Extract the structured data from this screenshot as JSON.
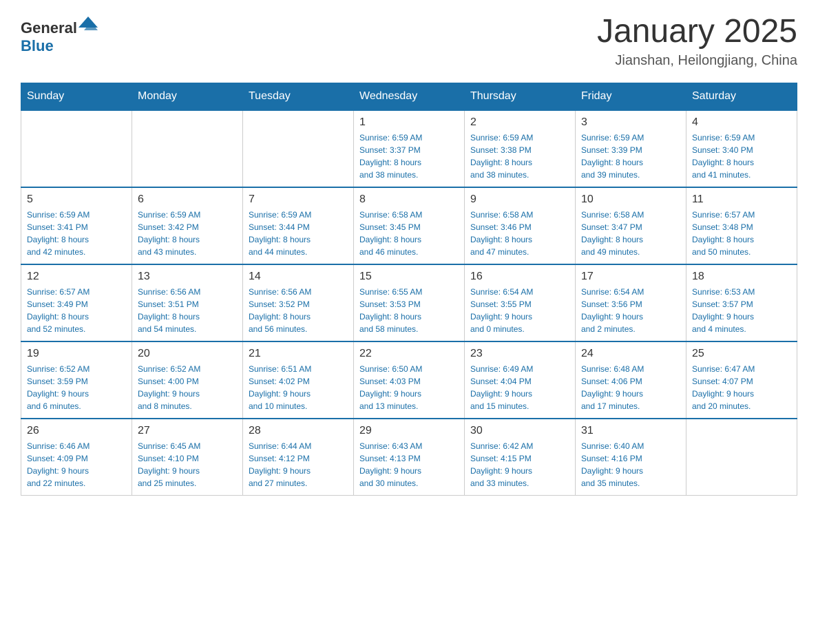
{
  "header": {
    "logo": {
      "general": "General",
      "blue": "Blue"
    },
    "title": "January 2025",
    "subtitle": "Jianshan, Heilongjiang, China"
  },
  "days_of_week": [
    "Sunday",
    "Monday",
    "Tuesday",
    "Wednesday",
    "Thursday",
    "Friday",
    "Saturday"
  ],
  "weeks": [
    [
      {
        "day": "",
        "info": ""
      },
      {
        "day": "",
        "info": ""
      },
      {
        "day": "",
        "info": ""
      },
      {
        "day": "1",
        "info": "Sunrise: 6:59 AM\nSunset: 3:37 PM\nDaylight: 8 hours\nand 38 minutes."
      },
      {
        "day": "2",
        "info": "Sunrise: 6:59 AM\nSunset: 3:38 PM\nDaylight: 8 hours\nand 38 minutes."
      },
      {
        "day": "3",
        "info": "Sunrise: 6:59 AM\nSunset: 3:39 PM\nDaylight: 8 hours\nand 39 minutes."
      },
      {
        "day": "4",
        "info": "Sunrise: 6:59 AM\nSunset: 3:40 PM\nDaylight: 8 hours\nand 41 minutes."
      }
    ],
    [
      {
        "day": "5",
        "info": "Sunrise: 6:59 AM\nSunset: 3:41 PM\nDaylight: 8 hours\nand 42 minutes."
      },
      {
        "day": "6",
        "info": "Sunrise: 6:59 AM\nSunset: 3:42 PM\nDaylight: 8 hours\nand 43 minutes."
      },
      {
        "day": "7",
        "info": "Sunrise: 6:59 AM\nSunset: 3:44 PM\nDaylight: 8 hours\nand 44 minutes."
      },
      {
        "day": "8",
        "info": "Sunrise: 6:58 AM\nSunset: 3:45 PM\nDaylight: 8 hours\nand 46 minutes."
      },
      {
        "day": "9",
        "info": "Sunrise: 6:58 AM\nSunset: 3:46 PM\nDaylight: 8 hours\nand 47 minutes."
      },
      {
        "day": "10",
        "info": "Sunrise: 6:58 AM\nSunset: 3:47 PM\nDaylight: 8 hours\nand 49 minutes."
      },
      {
        "day": "11",
        "info": "Sunrise: 6:57 AM\nSunset: 3:48 PM\nDaylight: 8 hours\nand 50 minutes."
      }
    ],
    [
      {
        "day": "12",
        "info": "Sunrise: 6:57 AM\nSunset: 3:49 PM\nDaylight: 8 hours\nand 52 minutes."
      },
      {
        "day": "13",
        "info": "Sunrise: 6:56 AM\nSunset: 3:51 PM\nDaylight: 8 hours\nand 54 minutes."
      },
      {
        "day": "14",
        "info": "Sunrise: 6:56 AM\nSunset: 3:52 PM\nDaylight: 8 hours\nand 56 minutes."
      },
      {
        "day": "15",
        "info": "Sunrise: 6:55 AM\nSunset: 3:53 PM\nDaylight: 8 hours\nand 58 minutes."
      },
      {
        "day": "16",
        "info": "Sunrise: 6:54 AM\nSunset: 3:55 PM\nDaylight: 9 hours\nand 0 minutes."
      },
      {
        "day": "17",
        "info": "Sunrise: 6:54 AM\nSunset: 3:56 PM\nDaylight: 9 hours\nand 2 minutes."
      },
      {
        "day": "18",
        "info": "Sunrise: 6:53 AM\nSunset: 3:57 PM\nDaylight: 9 hours\nand 4 minutes."
      }
    ],
    [
      {
        "day": "19",
        "info": "Sunrise: 6:52 AM\nSunset: 3:59 PM\nDaylight: 9 hours\nand 6 minutes."
      },
      {
        "day": "20",
        "info": "Sunrise: 6:52 AM\nSunset: 4:00 PM\nDaylight: 9 hours\nand 8 minutes."
      },
      {
        "day": "21",
        "info": "Sunrise: 6:51 AM\nSunset: 4:02 PM\nDaylight: 9 hours\nand 10 minutes."
      },
      {
        "day": "22",
        "info": "Sunrise: 6:50 AM\nSunset: 4:03 PM\nDaylight: 9 hours\nand 13 minutes."
      },
      {
        "day": "23",
        "info": "Sunrise: 6:49 AM\nSunset: 4:04 PM\nDaylight: 9 hours\nand 15 minutes."
      },
      {
        "day": "24",
        "info": "Sunrise: 6:48 AM\nSunset: 4:06 PM\nDaylight: 9 hours\nand 17 minutes."
      },
      {
        "day": "25",
        "info": "Sunrise: 6:47 AM\nSunset: 4:07 PM\nDaylight: 9 hours\nand 20 minutes."
      }
    ],
    [
      {
        "day": "26",
        "info": "Sunrise: 6:46 AM\nSunset: 4:09 PM\nDaylight: 9 hours\nand 22 minutes."
      },
      {
        "day": "27",
        "info": "Sunrise: 6:45 AM\nSunset: 4:10 PM\nDaylight: 9 hours\nand 25 minutes."
      },
      {
        "day": "28",
        "info": "Sunrise: 6:44 AM\nSunset: 4:12 PM\nDaylight: 9 hours\nand 27 minutes."
      },
      {
        "day": "29",
        "info": "Sunrise: 6:43 AM\nSunset: 4:13 PM\nDaylight: 9 hours\nand 30 minutes."
      },
      {
        "day": "30",
        "info": "Sunrise: 6:42 AM\nSunset: 4:15 PM\nDaylight: 9 hours\nand 33 minutes."
      },
      {
        "day": "31",
        "info": "Sunrise: 6:40 AM\nSunset: 4:16 PM\nDaylight: 9 hours\nand 35 minutes."
      },
      {
        "day": "",
        "info": ""
      }
    ]
  ]
}
